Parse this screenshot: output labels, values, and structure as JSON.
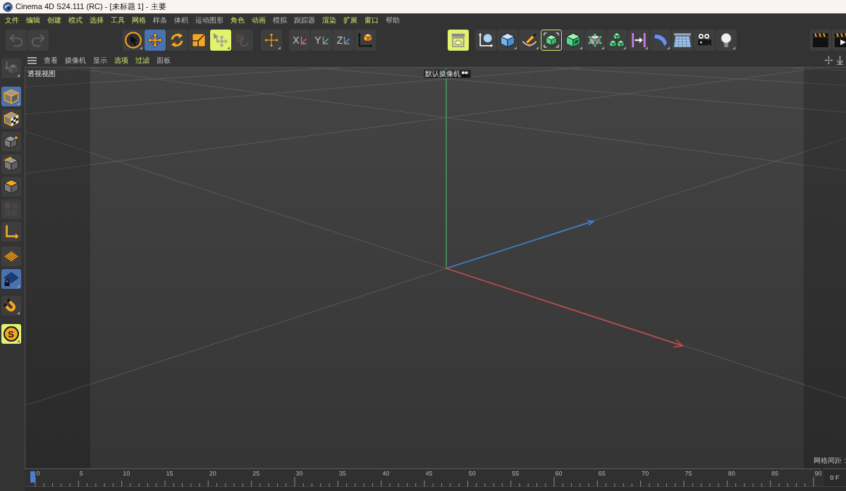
{
  "window": {
    "title": "Cinema 4D S24.111 (RC) - [未标题 1] - 主要"
  },
  "menu_bar": [
    {
      "label": "文件",
      "highlighted": true
    },
    {
      "label": "编辑",
      "highlighted": true
    },
    {
      "label": "创建",
      "highlighted": true
    },
    {
      "label": "模式",
      "highlighted": true
    },
    {
      "label": "选择",
      "highlighted": true
    },
    {
      "label": "工具",
      "highlighted": true
    },
    {
      "label": "网格",
      "highlighted": true
    },
    {
      "label": "样条",
      "highlighted": false
    },
    {
      "label": "体积",
      "highlighted": false
    },
    {
      "label": "运动图形",
      "highlighted": false
    },
    {
      "label": "角色",
      "highlighted": true
    },
    {
      "label": "动画",
      "highlighted": true
    },
    {
      "label": "模拟",
      "highlighted": false
    },
    {
      "label": "跟踪器",
      "highlighted": false
    },
    {
      "label": "渲染",
      "highlighted": true
    },
    {
      "label": "扩展",
      "highlighted": true
    },
    {
      "label": "窗口",
      "highlighted": true
    },
    {
      "label": "帮助",
      "highlighted": false
    }
  ],
  "toolbar": {
    "groups": [
      {
        "buttons": [
          {
            "selected": false,
            "highlighted": false,
            "disabled": true,
            "has_menu": false
          },
          {
            "selected": false,
            "highlighted": false,
            "disabled": true,
            "has_menu": false
          }
        ]
      },
      {
        "buttons": [
          {
            "selected": false,
            "highlighted": false,
            "disabled": false,
            "has_menu": true
          },
          {
            "selected": true,
            "highlighted": false,
            "disabled": false,
            "has_menu": false
          },
          {
            "selected": false,
            "highlighted": false,
            "disabled": false,
            "has_menu": false
          },
          {
            "selected": false,
            "highlighted": false,
            "disabled": false,
            "has_menu": false
          },
          {
            "selected": false,
            "highlighted": true,
            "disabled": false,
            "has_menu": true
          },
          {
            "selected": false,
            "highlighted": false,
            "disabled": true,
            "has_menu": false
          }
        ]
      },
      {
        "buttons": [
          {
            "selected": false,
            "highlighted": false,
            "disabled": false,
            "has_menu": true
          }
        ]
      },
      {
        "buttons": [
          {
            "label": "X",
            "selected": false,
            "highlighted": false,
            "disabled": false,
            "has_menu": false
          },
          {
            "label": "Y",
            "selected": false,
            "highlighted": false,
            "disabled": false,
            "has_menu": false
          },
          {
            "label": "Z",
            "selected": false,
            "highlighted": false,
            "disabled": false,
            "has_menu": false
          },
          {
            "selected": false,
            "highlighted": false,
            "disabled": false,
            "has_menu": false
          }
        ]
      },
      {
        "buttons": [
          {
            "selected": false,
            "highlighted": true,
            "disabled": false,
            "has_menu": false
          }
        ]
      },
      {
        "buttons": [
          {
            "selected": false,
            "highlighted": false,
            "outlined": false,
            "disabled": false,
            "has_menu": false
          },
          {
            "selected": false,
            "highlighted": false,
            "outlined": false,
            "disabled": false,
            "has_menu": true
          },
          {
            "selected": false,
            "highlighted": false,
            "outlined": false,
            "disabled": false,
            "has_menu": true
          },
          {
            "selected": false,
            "highlighted": false,
            "outlined": true,
            "disabled": false,
            "has_menu": false
          },
          {
            "selected": false,
            "highlighted": false,
            "outlined": false,
            "disabled": false,
            "has_menu": true
          },
          {
            "selected": false,
            "highlighted": false,
            "outlined": false,
            "disabled": false,
            "has_menu": true
          },
          {
            "selected": false,
            "highlighted": false,
            "outlined": false,
            "disabled": false,
            "has_menu": true
          },
          {
            "selected": false,
            "highlighted": false,
            "outlined": false,
            "disabled": false,
            "has_menu": true
          },
          {
            "selected": false,
            "highlighted": false,
            "outlined": false,
            "disabled": false,
            "has_menu": true
          },
          {
            "selected": false,
            "highlighted": false,
            "outlined": false,
            "disabled": false,
            "has_menu": false
          },
          {
            "selected": false,
            "highlighted": false,
            "outlined": false,
            "disabled": false,
            "has_menu": false
          },
          {
            "selected": false,
            "highlighted": false,
            "outlined": false,
            "disabled": false,
            "has_menu": true
          }
        ]
      },
      {
        "buttons": [
          {
            "selected": false,
            "highlighted": false,
            "disabled": false,
            "has_menu": false
          },
          {
            "selected": false,
            "highlighted": false,
            "disabled": false,
            "has_menu": false
          }
        ]
      }
    ]
  },
  "mode_bar": {
    "groups": [
      {
        "buttons": [
          {
            "selected": false,
            "highlighted": false,
            "disabled": true,
            "has_menu": true
          }
        ]
      },
      {
        "buttons": [
          {
            "selected": true,
            "highlighted": false,
            "disabled": false,
            "has_menu": true
          },
          {
            "selected": false,
            "highlighted": false,
            "disabled": false,
            "has_menu": false
          },
          {
            "selected": false,
            "highlighted": false,
            "disabled": false,
            "has_menu": false
          },
          {
            "selected": false,
            "highlighted": false,
            "disabled": false,
            "has_menu": false
          },
          {
            "selected": false,
            "highlighted": false,
            "disabled": false,
            "has_menu": false
          },
          {
            "selected": false,
            "highlighted": false,
            "disabled": true,
            "has_menu": false
          },
          {
            "selected": false,
            "highlighted": false,
            "disabled": false,
            "has_menu": false
          }
        ]
      },
      {
        "buttons": [
          {
            "selected": false,
            "highlighted": false,
            "disabled": false,
            "has_menu": false
          },
          {
            "selected": true,
            "highlighted": false,
            "disabled": false,
            "has_menu": true
          }
        ]
      },
      {
        "buttons": [
          {
            "selected": false,
            "highlighted": false,
            "disabled": false,
            "has_menu": true
          }
        ]
      },
      {
        "buttons": [
          {
            "label": "S",
            "selected": false,
            "highlighted": true,
            "disabled": false,
            "has_menu": true
          }
        ]
      }
    ]
  },
  "viewport": {
    "menu": [
      {
        "label": "查看",
        "highlighted": false
      },
      {
        "label": "摄像机",
        "highlighted": false
      },
      {
        "label": "显示",
        "highlighted": false
      },
      {
        "label": "选项",
        "highlighted": true
      },
      {
        "label": "过滤",
        "highlighted": true
      },
      {
        "label": "面板",
        "highlighted": false
      }
    ],
    "view_name": "透视视图",
    "camera_label": "默认摄像机",
    "grid_spacing_label": "网格间距 :"
  },
  "timeline": {
    "frame_labels": [
      "0",
      "5",
      "10",
      "15",
      "20",
      "25",
      "30",
      "35",
      "40",
      "45",
      "50",
      "55",
      "60",
      "65",
      "70",
      "75",
      "80",
      "85",
      "90"
    ],
    "playhead": {
      "level": 0
    },
    "current_frame": "0 F"
  }
}
